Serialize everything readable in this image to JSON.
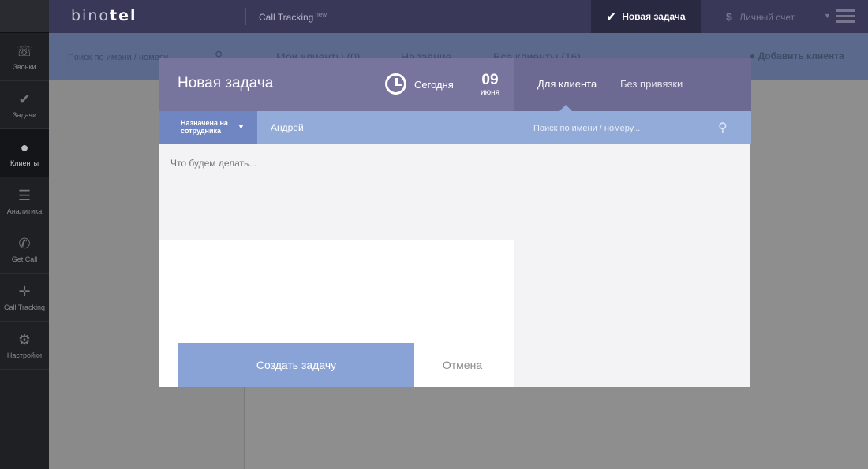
{
  "rail": {
    "items": [
      {
        "icon": "phone-icon",
        "glyph": "☏",
        "label": "Звонки",
        "active": false
      },
      {
        "icon": "check-icon",
        "glyph": "✔",
        "label": "Задачи",
        "active": false
      },
      {
        "icon": "user-icon",
        "glyph": "●",
        "label": "Клиенты",
        "active": true
      },
      {
        "icon": "analytics-icon",
        "glyph": "☰",
        "label": "Аналитика",
        "active": false
      },
      {
        "icon": "get-call-icon",
        "glyph": "✆",
        "label": "Get Call",
        "active": false
      },
      {
        "icon": "crosshair-icon",
        "glyph": "✛",
        "label": "Call Tracking",
        "active": false
      },
      {
        "icon": "gear-icon",
        "glyph": "⚙",
        "label": "Настройки",
        "active": false
      }
    ]
  },
  "topbar": {
    "logo_pre": "bino",
    "logo_bold": "tel",
    "call_tracking": "Call Tracking",
    "call_tracking_badge": "new",
    "new_task": "Новая задача",
    "account": "Личный счет"
  },
  "subbar": {
    "search_placeholder": "Поиск по имени / номеру",
    "tabs": [
      "Мои клиенты (0)",
      "Недавние",
      "Все клиенты (16)"
    ],
    "add_client": "Добавить клиента"
  },
  "modal": {
    "title": "Новая задача",
    "today": "Сегодня",
    "day": "09",
    "month": "июня",
    "assign_label_line1": "Назначена на",
    "assign_label_line2": "сотрудника",
    "assignee": "Андрей",
    "task_placeholder": "Что будем делать...",
    "create_button": "Создать задачу",
    "cancel_button": "Отмена",
    "right_tabs": [
      "Для клиента",
      "Без привязки"
    ],
    "client_search_placeholder": "Поиск по имени / номеру..."
  },
  "colors": {
    "topbar": "#3a3858",
    "modal_header": "#77749e",
    "accent_blue": "#8aa3d6"
  }
}
